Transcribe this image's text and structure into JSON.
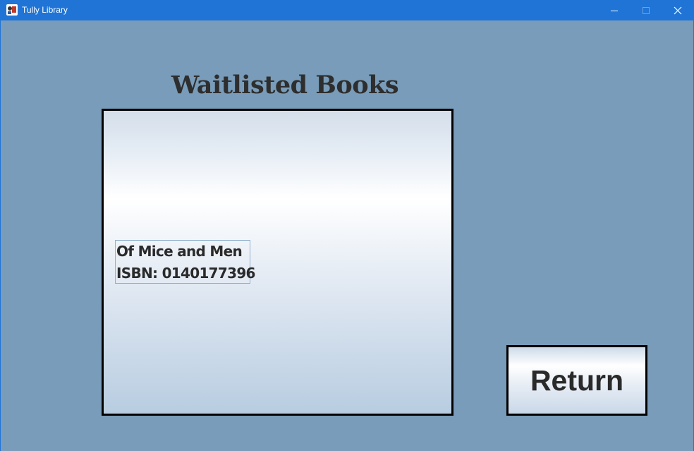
{
  "window": {
    "title": "Tully Library",
    "icon": "library-app-icon",
    "controls": [
      "minimize-icon",
      "maximize-icon",
      "close-icon"
    ]
  },
  "main": {
    "heading": "Waitlisted Books",
    "waitlist": [
      {
        "title": "Of Mice and Men",
        "isbn_line": "ISBN: 0140177396"
      }
    ],
    "return_label": "Return"
  },
  "colors": {
    "titlebar": "#1f74d6",
    "background": "#789cb9",
    "text": "#2e2e2e"
  }
}
